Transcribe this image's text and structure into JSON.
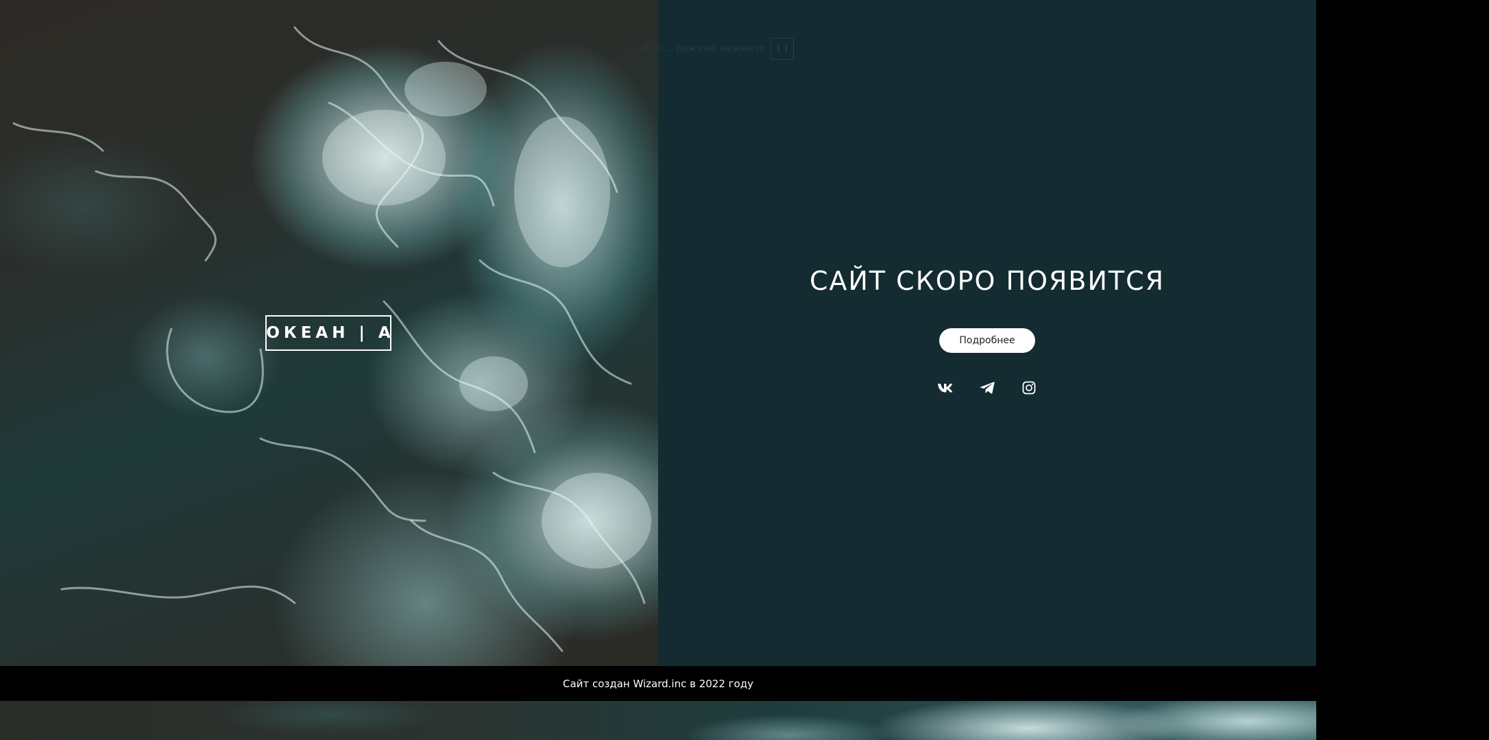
{
  "hero": {
    "logo_text": "ОКЕАН | А"
  },
  "accessibility_hint": {
    "text": "Для ... режима нажмите",
    "key_label": "[ ]"
  },
  "main": {
    "headline": "САЙТ СКОРО ПОЯВИТСЯ",
    "more_button_label": "Подробнее"
  },
  "socials": [
    {
      "name": "vk",
      "icon": "vk-icon"
    },
    {
      "name": "telegram",
      "icon": "telegram-icon"
    },
    {
      "name": "instagram",
      "icon": "instagram-icon"
    }
  ],
  "footer": {
    "text": "Сайт создан Wizard.inc в 2022 году"
  },
  "colors": {
    "panel_background": "#132b31",
    "footer_background": "#000000",
    "text": "#ffffff",
    "button_background": "#ffffff"
  }
}
